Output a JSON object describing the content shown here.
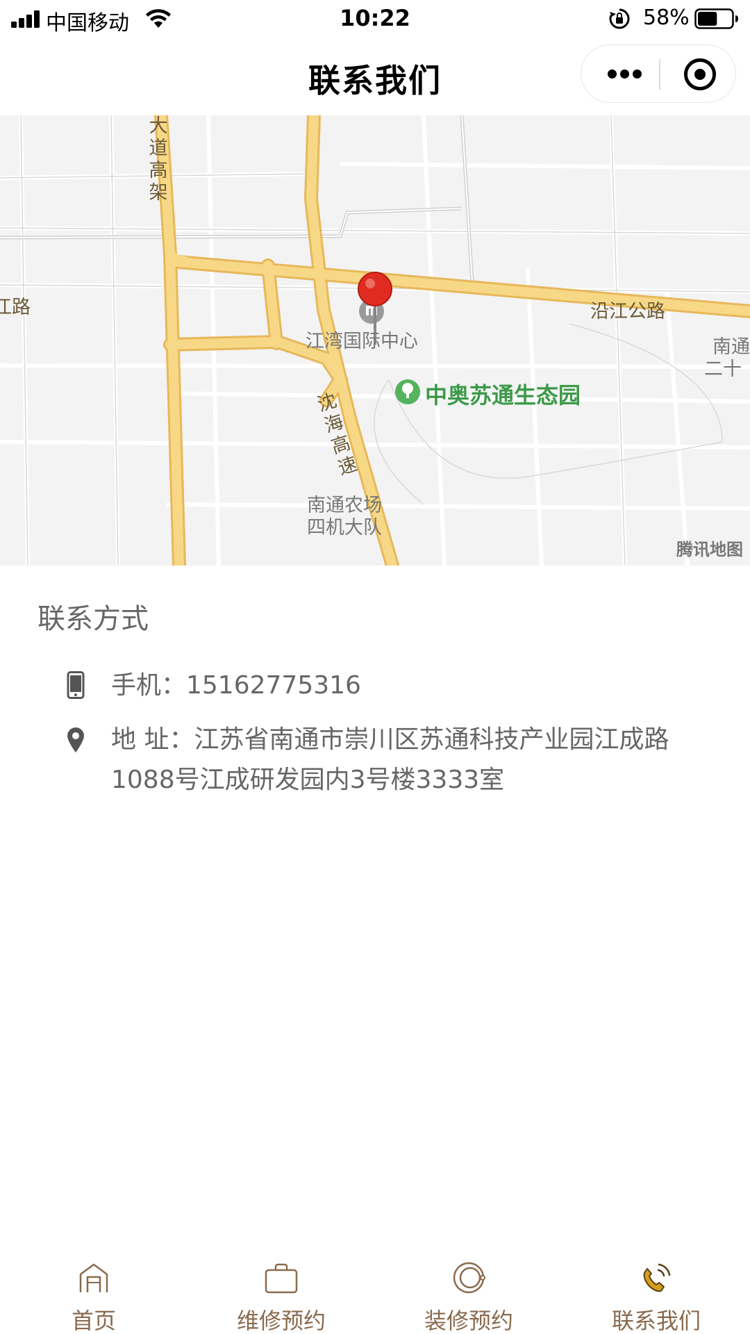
{
  "status_bar": {
    "carrier": "中国移动",
    "time": "10:22",
    "battery_percent": "58%",
    "battery_level": 0.58
  },
  "nav": {
    "title": "联系我们"
  },
  "map": {
    "labels": {
      "road_left_vertical": "大道高架",
      "road_left": "江路",
      "road_right": "沿江公路",
      "highway": "沈海高速",
      "poi_center": "江湾国际中心",
      "park": "中奥苏通生态园",
      "poi_south_1": "南通农场",
      "poi_south_2": "四机大队",
      "edge_1": "南通",
      "edge_2": "二十"
    },
    "attribution": "腾讯地图"
  },
  "contact": {
    "title": "联系方式",
    "phone": "手机：15162775316",
    "address": "地 址：江苏省南通市崇川区苏通科技产业园江成路1088号江成研发园内3号楼3333室"
  },
  "tabs": [
    {
      "label": "首页",
      "icon": "home-icon"
    },
    {
      "label": "维修预约",
      "icon": "bag-icon"
    },
    {
      "label": "装修预约",
      "icon": "ring-icon"
    },
    {
      "label": "联系我们",
      "icon": "phone-call-icon"
    }
  ],
  "colors": {
    "tab_label": "#8a6a4e",
    "tab_active_icon": "#d4a017",
    "road_yellow": "#f5d37c",
    "park_green": "#3d9a4a",
    "pin_red": "#e02b20"
  }
}
